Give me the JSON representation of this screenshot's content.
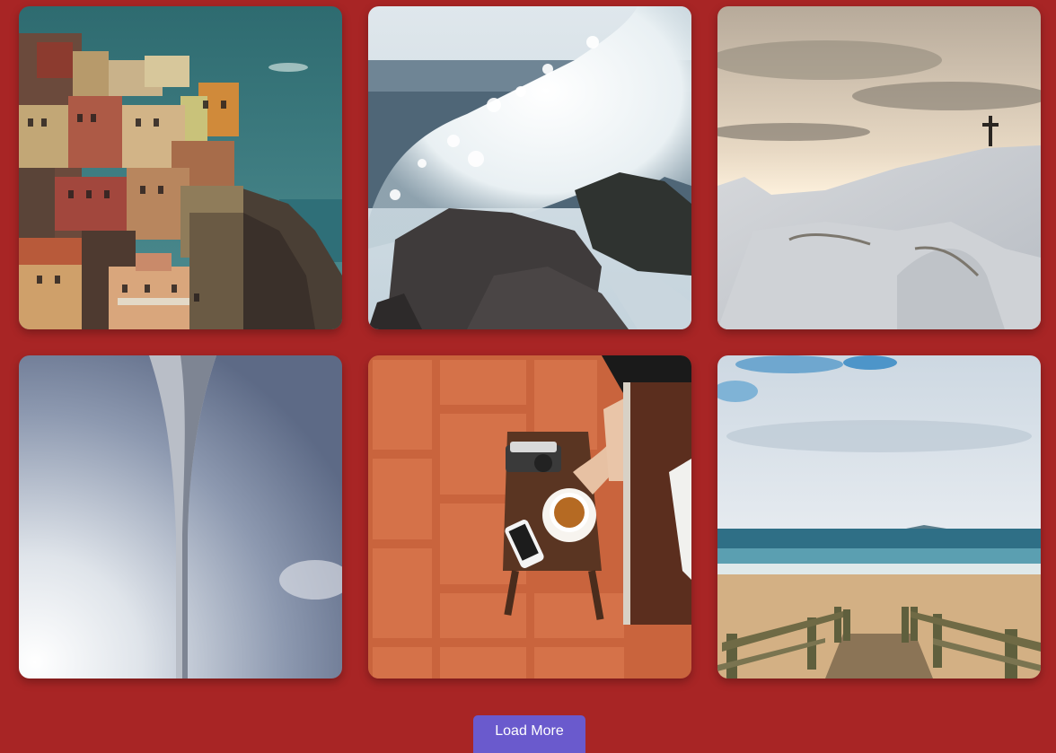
{
  "gallery": {
    "photos": [
      {
        "subject": "coastal-village-cliff"
      },
      {
        "subject": "wave-crashing-rocks"
      },
      {
        "subject": "snowy-hill-with-cross"
      },
      {
        "subject": "bridge-pylon-sky"
      },
      {
        "subject": "coffee-table-tiles"
      },
      {
        "subject": "beach-boardwalk"
      }
    ]
  },
  "load_more": {
    "label": "Load More"
  },
  "colors": {
    "background": "#a82525",
    "button": "#6a5acd",
    "button_text": "#ffffff"
  }
}
